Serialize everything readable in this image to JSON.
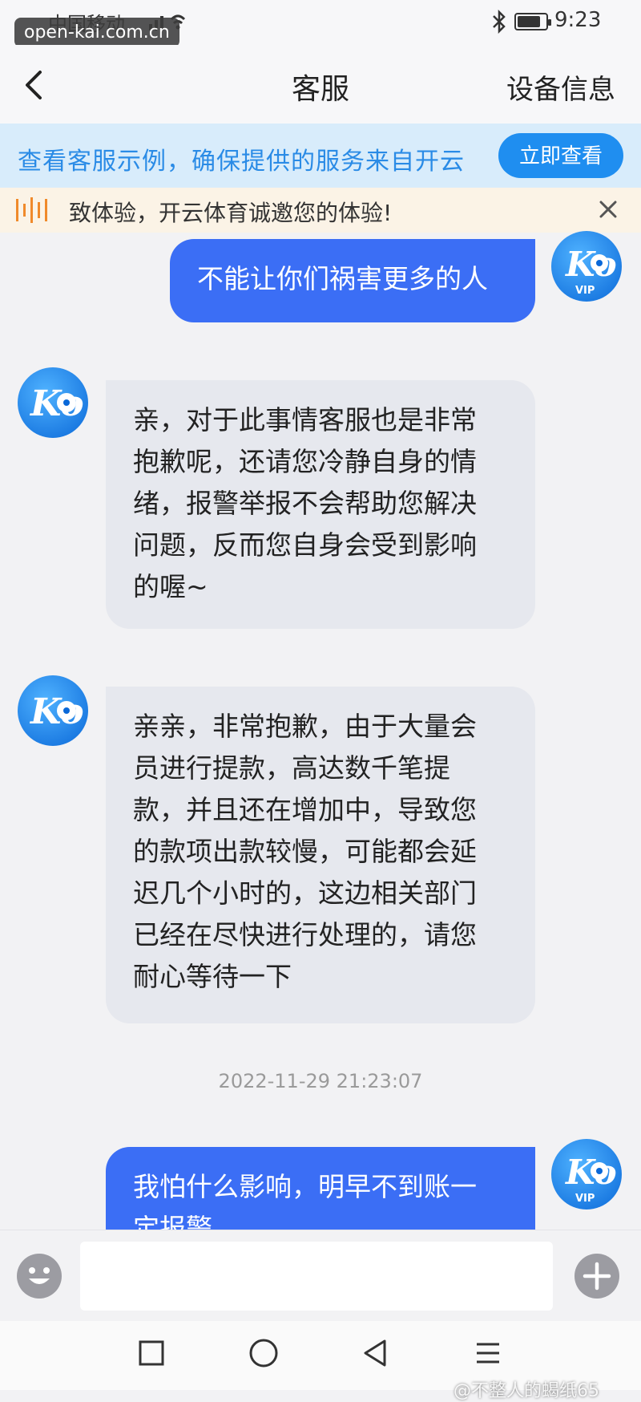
{
  "status_bar": {
    "carrier": "中国移动",
    "watermark": "open-kai.com.cn",
    "time": "9:23"
  },
  "header": {
    "title": "客服",
    "device_info": "设备信息"
  },
  "banner": {
    "text": "查看客服示例，确保提供的服务来自开云",
    "button": "立即查看"
  },
  "notice": {
    "text": "致体验，开云体育诚邀您的体验!"
  },
  "messages": [
    {
      "sender": "user",
      "text": "不能让你们祸害更多的人"
    },
    {
      "sender": "agent",
      "lines": [
        "亲，对于此事情客服也是非常",
        "抱歉呢，还请您冷静自身的情",
        "绪，报警举报不会帮助您解决",
        "问题，反而您自身会受到影响",
        "的喔~"
      ]
    },
    {
      "sender": "agent",
      "lines": [
        "亲亲，非常抱歉，由于大量会",
        "员进行提款，高达数千笔提",
        "款，并且还在增加中，导致您",
        "的款项出款较慢，可能都会延",
        "迟几个小时的，这边相关部门",
        "已经在尽快进行处理的，请您",
        "耐心等待一下"
      ]
    },
    {
      "sender": "user",
      "lines": [
        "我怕什么影响，明早不到账一",
        "定报警"
      ]
    }
  ],
  "timestamp": "2022-11-29 21:23:07",
  "avatar": {
    "text": "Ko",
    "badge": "VIP"
  },
  "input": {
    "placeholder": ""
  },
  "watermark_bottom": "@不整人的蝎纸65"
}
